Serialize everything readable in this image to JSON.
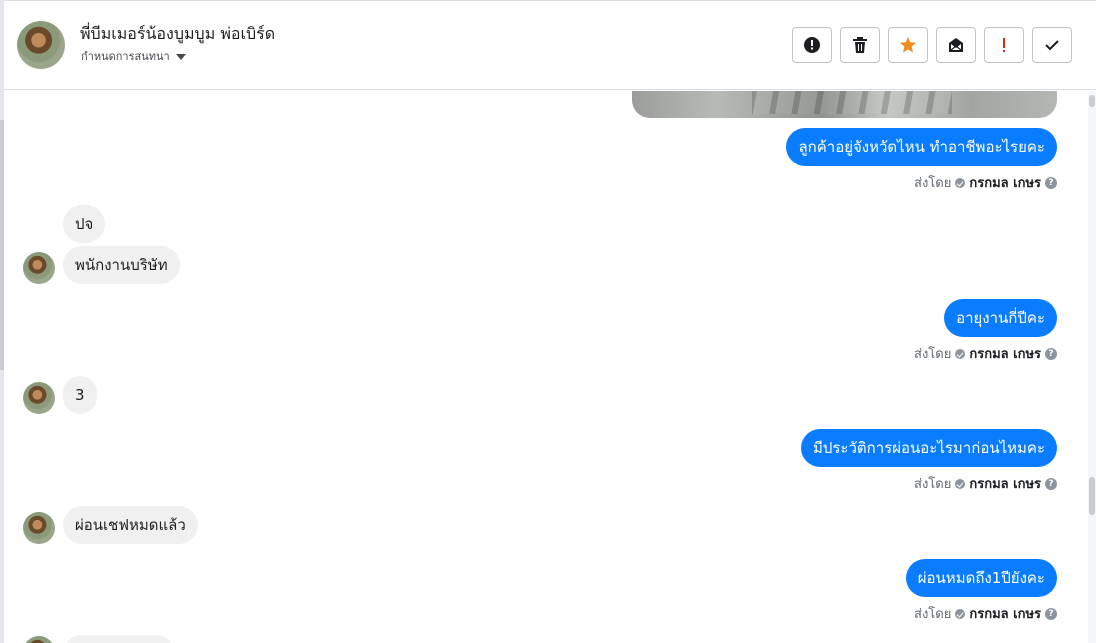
{
  "header": {
    "contact_name": "พี่บีมเมอร์น้องบูมบูม พ่อเบิร์ด",
    "assign_label": "กำหนดการสนทนา",
    "actions": [
      {
        "name": "report-spam-button",
        "icon": "exclamation-circle-icon"
      },
      {
        "name": "delete-button",
        "icon": "trash-icon"
      },
      {
        "name": "star-button",
        "icon": "star-icon",
        "color": "#f28b1d"
      },
      {
        "name": "mark-unread-button",
        "icon": "envelope-open-icon"
      },
      {
        "name": "follow-up-button",
        "icon": "exclamation-icon",
        "color": "#e02020"
      },
      {
        "name": "mark-done-button",
        "icon": "check-icon"
      }
    ]
  },
  "sender_label": "ส่งโดย",
  "agent_name": "กรกมล เกษร",
  "messages": {
    "out_1": "ลูกค้าอยู่จังหวัดไหน ทำอาชีพอะไรยคะ",
    "in_1": "ปจ",
    "in_2": "พนักงานบริษัท",
    "out_2": "อายุงานกี่ปีคะ",
    "in_3": "3",
    "out_3": "มีประวัติการผ่อนอะไรมาก่อนไหมคะ",
    "in_4": "ผ่อนเชฟหมดแล้ว",
    "out_4": "ผ่อนหมดถึง1ปียังคะ"
  },
  "colors": {
    "outgoing_bubble": "#0a7cff",
    "incoming_bubble": "#f0f0f0"
  }
}
